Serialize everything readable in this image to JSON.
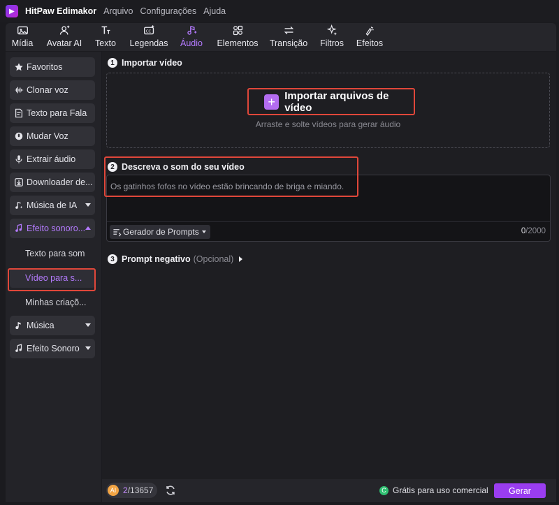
{
  "titlebar": {
    "app_name": "HitPaw Edimakor",
    "menu": [
      "Arquivo",
      "Configurações",
      "Ajuda"
    ]
  },
  "toolbar": {
    "tools": [
      {
        "label": "Mídia",
        "icon": "media-icon"
      },
      {
        "label": "Avatar AI",
        "icon": "avatar-icon"
      },
      {
        "label": "Texto",
        "icon": "text-icon"
      },
      {
        "label": "Legendas",
        "icon": "captions-icon"
      },
      {
        "label": "Áudio",
        "icon": "audio-icon",
        "active": true
      },
      {
        "label": "Elementos",
        "icon": "elements-icon"
      },
      {
        "label": "Transição",
        "icon": "transition-icon"
      },
      {
        "label": "Filtros",
        "icon": "filters-icon"
      },
      {
        "label": "Efeitos",
        "icon": "effects-icon"
      }
    ]
  },
  "sidebar": {
    "items": [
      {
        "label": "Favoritos",
        "icon": "star-icon"
      },
      {
        "label": "Clonar voz",
        "icon": "waveform-icon"
      },
      {
        "label": "Texto para Fala",
        "icon": "text-to-speech-icon"
      },
      {
        "label": "Mudar Voz",
        "icon": "voice-changer-icon"
      },
      {
        "label": "Extrair áudio",
        "icon": "microphone-icon"
      },
      {
        "label": "Downloader de...",
        "icon": "download-icon"
      },
      {
        "label": "Música de IA",
        "icon": "ai-music-icon"
      },
      {
        "label": "Efeito sonoro...",
        "icon": "sound-effect-icon"
      }
    ],
    "sub_items": [
      "Texto para som",
      "Vídeo para s...",
      "Minhas criaçõ..."
    ],
    "bottom_items": [
      {
        "label": "Música",
        "icon": "music-note-icon"
      },
      {
        "label": "Efeito Sonoro",
        "icon": "sound-note-icon"
      }
    ]
  },
  "main": {
    "step1": {
      "number": "1",
      "title": "Importar vídeo"
    },
    "import_button_label": "Importar arquivos de vídeo",
    "drop_hint": "Arraste e solte vídeos para gerar áudio",
    "step2": {
      "number": "2",
      "title": "Descreva o som do seu vídeo"
    },
    "prompt_text": "Os gatinhos fofos no vídeo estão brincando de briga e miando.",
    "prompt_generator_label": "Gerador de Prompts",
    "char_count": "0",
    "char_limit": "/2000",
    "step3": {
      "number": "3",
      "title": "Prompt negativo",
      "optional": "(Opcional)"
    }
  },
  "bottombar": {
    "credits_used": "2",
    "credits_total": "/13657",
    "free_label": "Grátis para uso comercial",
    "generate_label": "Gerar"
  },
  "colors": {
    "accent": "#b57bff",
    "highlight_box": "#e0473a",
    "generate_button": "#9a3df0"
  }
}
